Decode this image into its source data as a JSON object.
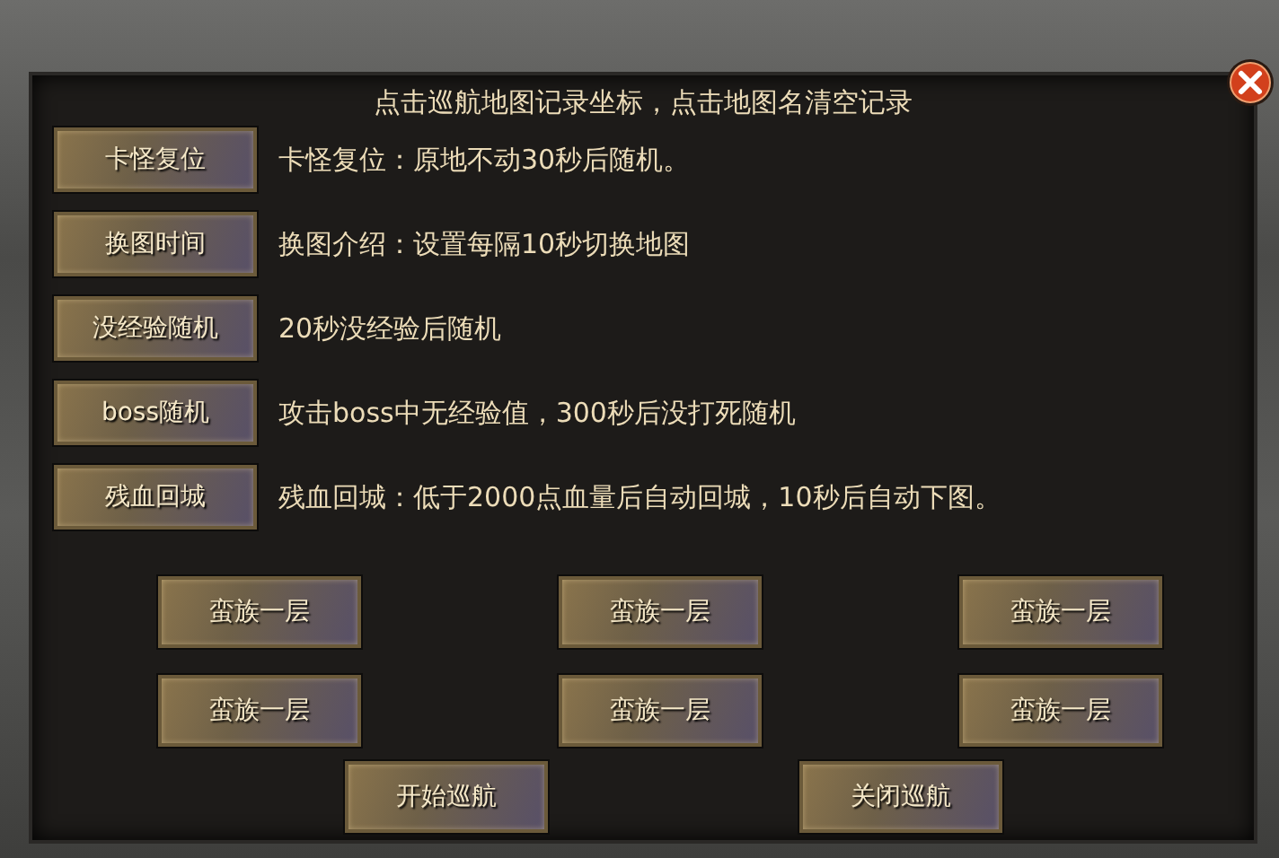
{
  "header": "点击巡航地图记录坐标，点击地图名清空记录",
  "rows": [
    {
      "button": "卡怪复位",
      "description": "卡怪复位：原地不动30秒后随机。"
    },
    {
      "button": "换图时间",
      "description": "换图介绍：设置每隔10秒切换地图"
    },
    {
      "button": "没经验随机",
      "description": "20秒没经验后随机"
    },
    {
      "button": "boss随机",
      "description": "攻击boss中无经验值，300秒后没打死随机"
    },
    {
      "button": "残血回城",
      "description": "残血回城：低于2000点血量后自动回城，10秒后自动下图。"
    }
  ],
  "map_buttons": [
    "蛮族一层",
    "蛮族一层",
    "蛮族一层",
    "蛮族一层",
    "蛮族一层",
    "蛮族一层"
  ],
  "actions": [
    "开始巡航",
    "关闭巡航"
  ]
}
